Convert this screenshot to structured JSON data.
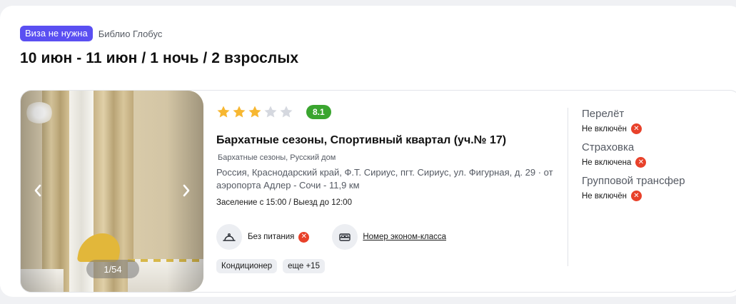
{
  "header": {
    "visa_badge": "Виза не нужна",
    "operator": "Библио Глобус",
    "dates": "10 июн - 11 июн / 1 ночь / 2 взрослых"
  },
  "hotel": {
    "stars_filled": 3,
    "stars_total": 5,
    "score": "8.1",
    "name": "Бархатные сезоны, Спортивный квартал (уч.№ 17)",
    "alt_name": "Бархатные сезоны, Русский дом",
    "address": "Россия, Краснодарский край, Ф.Т. Сириус, пгт. Сириус, ул. Фигурная, д. 29 · от аэропорта Адлер - Сочи - 11,9 км",
    "checkin": "Заселение с 15:00 / Выезд до 12:00",
    "photo_counter": "1/54",
    "meal": "Без питания",
    "room": "Номер эконом-класса",
    "tags": [
      "Кондиционер",
      "еще +15"
    ]
  },
  "services": [
    {
      "title": "Перелёт",
      "status": "Не включён"
    },
    {
      "title": "Страховка",
      "status": "Не включена"
    },
    {
      "title": "Групповой трансфер",
      "status": "Не включён"
    }
  ],
  "colors": {
    "visa_badge": "#5a4ff2",
    "score_badge": "#3aa52f",
    "star_filled": "#f7b731",
    "star_empty": "#d5d8df",
    "cross_badge": "#e8412a"
  }
}
